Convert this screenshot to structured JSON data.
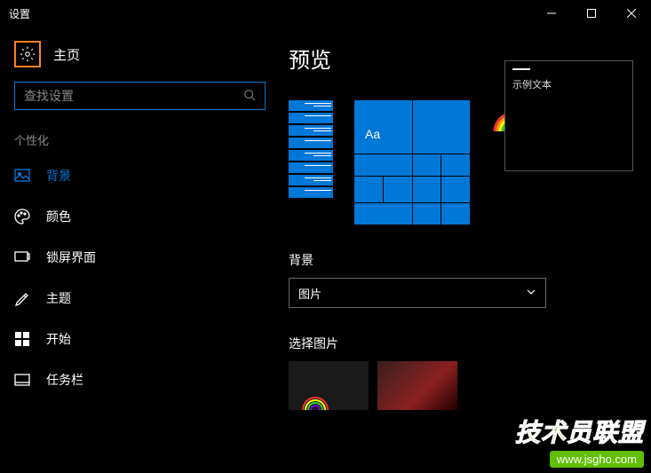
{
  "titlebar": {
    "title": "设置"
  },
  "home": {
    "label": "主页"
  },
  "search": {
    "placeholder": "查找设置"
  },
  "category": "个性化",
  "nav": [
    {
      "icon": "image",
      "label": "背景",
      "active": true
    },
    {
      "icon": "palette",
      "label": "颜色"
    },
    {
      "icon": "lock-screen",
      "label": "锁屏界面"
    },
    {
      "icon": "theme",
      "label": "主题"
    },
    {
      "icon": "start",
      "label": "开始"
    },
    {
      "icon": "taskbar",
      "label": "任务栏"
    }
  ],
  "content": {
    "heading": "预览",
    "sample_text": "示例文本",
    "aa": "Aa",
    "bg_section": "背景",
    "dropdown_value": "图片",
    "choose_label": "选择图片"
  },
  "watermark": {
    "main": "技术员联盟",
    "sub": "www.jsgho.com"
  },
  "colors": {
    "accent": "#0078d7",
    "highlight_border": "#FF7F27",
    "watermark_green": "#5FBF00"
  }
}
